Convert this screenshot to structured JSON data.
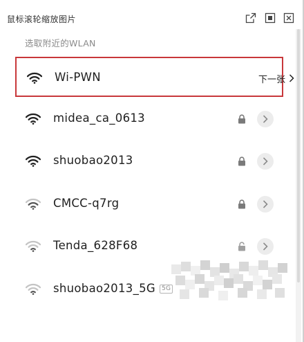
{
  "window": {
    "title": "鼠标滚轮缩放图片",
    "controls": [
      "popout-icon",
      "maximize-icon",
      "close-icon"
    ]
  },
  "wlan": {
    "section_title": "选取附近的WLAN",
    "next_label": "下一张",
    "networks": [
      {
        "name": "Wi-PWN",
        "signal": "strong",
        "secured": false,
        "band": ""
      },
      {
        "name": "midea_ca_0613",
        "signal": "strong",
        "secured": true,
        "band": ""
      },
      {
        "name": "shuobao2013",
        "signal": "strong",
        "secured": true,
        "band": ""
      },
      {
        "name": "CMCC-q7rg",
        "signal": "weak",
        "secured": true,
        "band": ""
      },
      {
        "name": "Tenda_628F68",
        "signal": "weak",
        "secured": true,
        "band": ""
      },
      {
        "name": "shuobao2013_5G",
        "signal": "weak",
        "secured": true,
        "band": "5G"
      }
    ]
  },
  "colors": {
    "highlight_border": "#c8373a",
    "section_title": "#8a8a8a",
    "chevron_bg": "#ececec"
  }
}
